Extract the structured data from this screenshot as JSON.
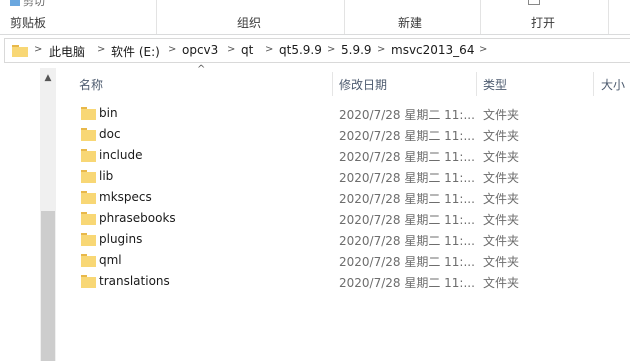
{
  "ribbon": {
    "clipped_top_label": "剪切",
    "groups": [
      {
        "label": "剪贴板"
      },
      {
        "label": "组织"
      },
      {
        "label": "新建"
      },
      {
        "label": "打开"
      }
    ]
  },
  "address": {
    "crumbs": [
      "此电脑",
      "软件 (E:)",
      "opcv3",
      "qt",
      "qt5.9.9",
      "5.9.9",
      "msvc2013_64"
    ]
  },
  "columns": {
    "name": "名称",
    "date": "修改日期",
    "type": "类型",
    "size": "大小"
  },
  "files": [
    {
      "name": "bin",
      "date": "2020/7/28 星期二 11:...",
      "type": "文件夹"
    },
    {
      "name": "doc",
      "date": "2020/7/28 星期二 11:...",
      "type": "文件夹"
    },
    {
      "name": "include",
      "date": "2020/7/28 星期二 11:...",
      "type": "文件夹"
    },
    {
      "name": "lib",
      "date": "2020/7/28 星期二 11:...",
      "type": "文件夹"
    },
    {
      "name": "mkspecs",
      "date": "2020/7/28 星期二 11:...",
      "type": "文件夹"
    },
    {
      "name": "phrasebooks",
      "date": "2020/7/28 星期二 11:...",
      "type": "文件夹"
    },
    {
      "name": "plugins",
      "date": "2020/7/28 星期二 11:...",
      "type": "文件夹"
    },
    {
      "name": "qml",
      "date": "2020/7/28 星期二 11:...",
      "type": "文件夹"
    },
    {
      "name": "translations",
      "date": "2020/7/28 星期二 11:...",
      "type": "文件夹"
    }
  ],
  "icons": {
    "folder": "folder-icon",
    "chevron": "chevron-right-icon",
    "sort": "sort-ascending-icon",
    "scroll_up": "scroll-up-icon"
  },
  "colors": {
    "folder_fill": "#f8d775",
    "folder_tab": "#e8b84a",
    "header_text": "#4d5b6f"
  }
}
